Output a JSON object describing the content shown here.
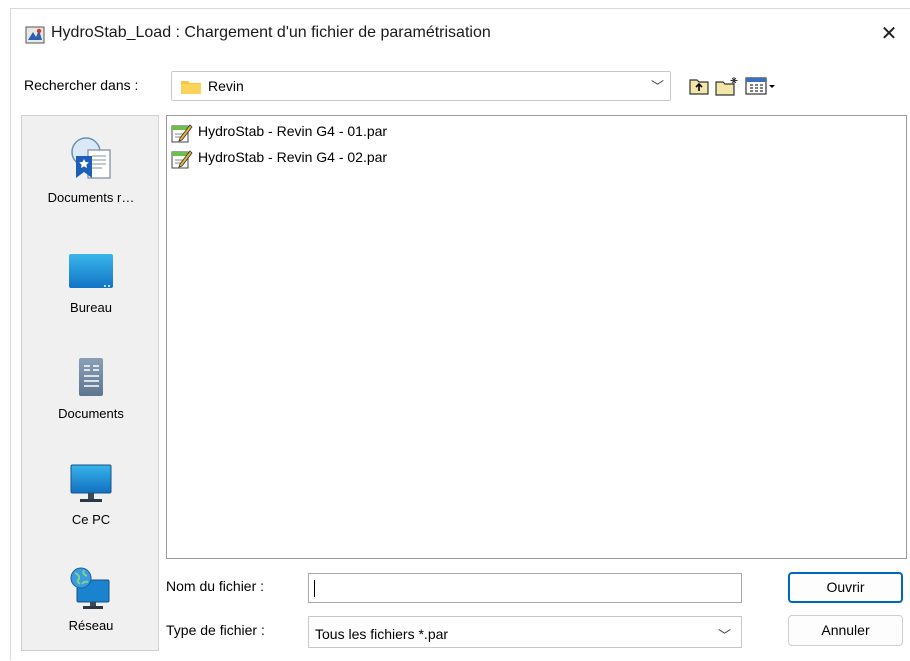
{
  "window": {
    "title": "HydroStab_Load : Chargement d'un fichier de paramétrisation",
    "close_glyph": "✕",
    "app_icon": "hydrostab-app-icon"
  },
  "lookin": {
    "label": "Rechercher dans :",
    "value": "Revin",
    "folder_icon": "folder-icon"
  },
  "toolbar": {
    "up_icon": "folder-up-icon",
    "new_folder_icon": "new-folder-icon",
    "view_menu_icon": "view-menu-icon"
  },
  "places": [
    {
      "label": "Documents r…",
      "icon": "recent-documents-icon"
    },
    {
      "label": "Bureau",
      "icon": "desktop-icon"
    },
    {
      "label": "Documents",
      "icon": "documents-icon"
    },
    {
      "label": "Ce PC",
      "icon": "computer-icon"
    },
    {
      "label": "Réseau",
      "icon": "network-icon"
    }
  ],
  "files": [
    {
      "name": "HydroStab - Revin G4 - 01.par",
      "icon": "par-file-icon"
    },
    {
      "name": "HydroStab - Revin G4 - 02.par",
      "icon": "par-file-icon"
    }
  ],
  "filename": {
    "label": "Nom du fichier :",
    "value": ""
  },
  "filetype": {
    "label": "Type de fichier :",
    "value": "Tous les fichiers *.par"
  },
  "buttons": {
    "open": "Ouvrir",
    "cancel": "Annuler"
  },
  "colors": {
    "accent": "#0067c0",
    "places_bg": "#f0f0f0"
  }
}
